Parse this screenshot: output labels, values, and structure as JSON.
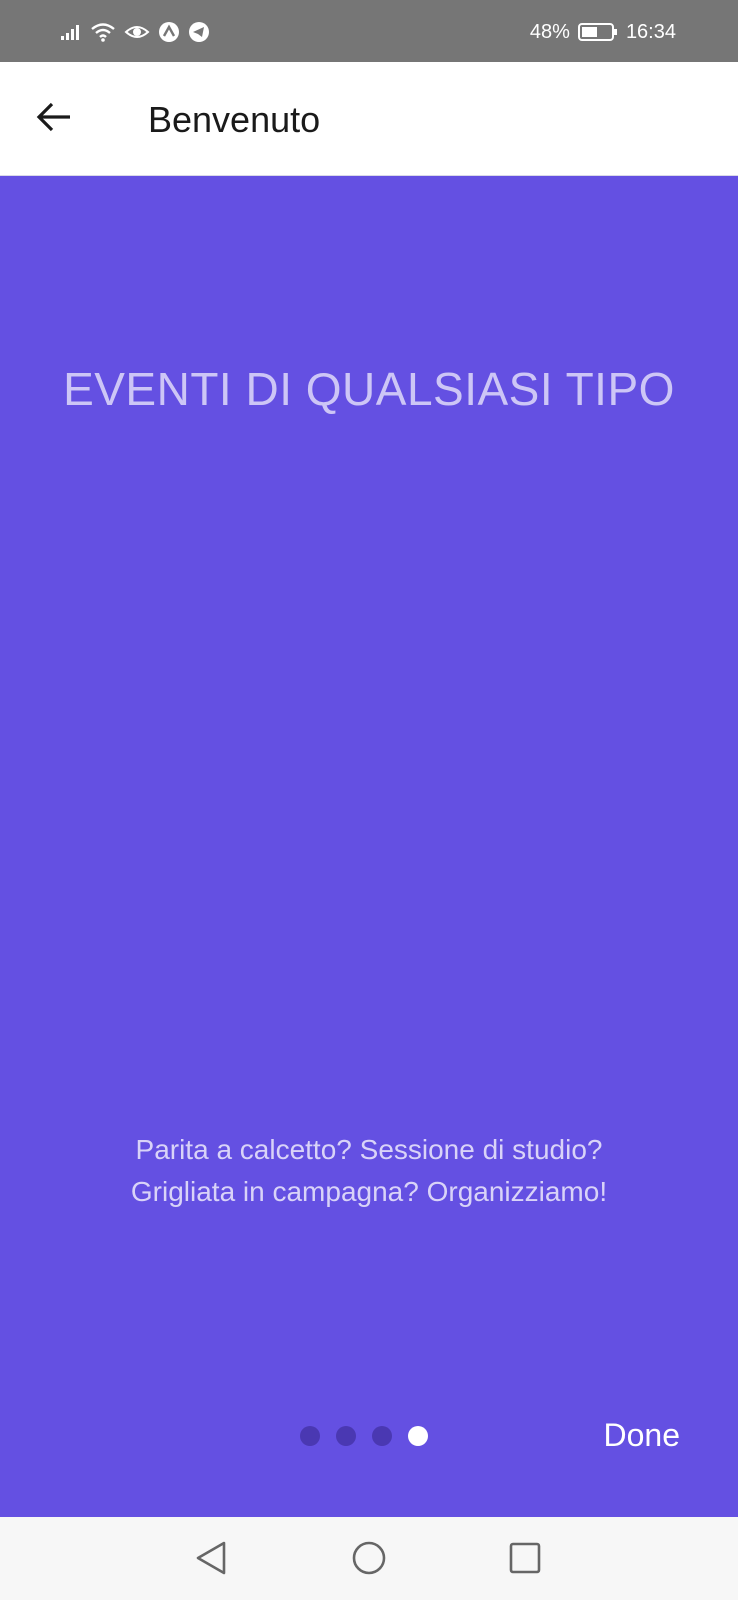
{
  "status_bar": {
    "battery_percent": "48%",
    "time": "16:34",
    "icons": [
      "signal-icon",
      "wifi-icon",
      "eye-icon",
      "arrow-app-icon",
      "telegram-icon",
      "battery-icon"
    ]
  },
  "app_bar": {
    "title": "Benvenuto",
    "back_icon": "arrow-left-icon"
  },
  "slide": {
    "title": "EVENTI DI QUALSIASI TIPO",
    "description_line1": "Parita a calcetto? Sessione di studio?",
    "description_line2": "Grigliata in campagna? Organizziamo!",
    "page_count": 4,
    "current_page": 4
  },
  "actions": {
    "done_label": "Done"
  },
  "colors": {
    "background": "#6450e2",
    "title_text": "#cdc6f6",
    "dot_inactive": "#4a38b2",
    "dot_active": "#ffffff",
    "status_bar": "#767676"
  },
  "nav_bar": {
    "icons": [
      "back-triangle-icon",
      "home-circle-icon",
      "recents-square-icon"
    ]
  }
}
